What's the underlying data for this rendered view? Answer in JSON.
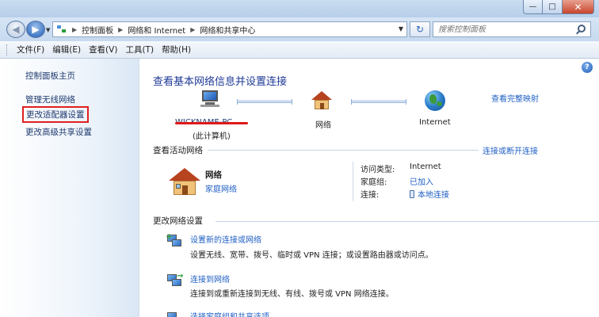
{
  "window": {
    "minimize": "—",
    "maximize": "□",
    "close": "✕"
  },
  "address": {
    "crumbs": [
      "控制面板",
      "网络和 Internet",
      "网络和共享中心"
    ],
    "search_placeholder": "搜索控制面板"
  },
  "menu": {
    "items": [
      "文件(F)",
      "编辑(E)",
      "查看(V)",
      "工具(T)",
      "帮助(H)"
    ]
  },
  "sidebar": {
    "items": [
      "控制面板主页",
      "管理无线网络",
      "更改适配器设置",
      "更改高级共享设置"
    ]
  },
  "main": {
    "title": "查看基本网络信息并设置连接",
    "full_map_link": "查看完整映射",
    "map": {
      "computer_name": "WICKNAME-PC",
      "computer_sub": "(此计算机)",
      "network": "网络",
      "internet": "Internet"
    },
    "active_header": "查看活动网络",
    "connect_link": "连接或断开连接",
    "active_network": {
      "name": "网络",
      "type": "家庭网络",
      "labels": [
        "访问类型:",
        "家庭组:",
        "连接:"
      ],
      "access_type": "Internet",
      "homegroup": "已加入",
      "connection": "本地连接"
    },
    "change_header": "更改网络设置",
    "tasks": [
      {
        "title": "设置新的连接或网络",
        "desc": "设置无线、宽带、拨号、临时或 VPN 连接；或设置路由器或访问点。"
      },
      {
        "title": "连接到网络",
        "desc": "连接到或重新连接到无线、有线、拨号或 VPN 网络连接。"
      },
      {
        "title": "选择家庭组和共享选项",
        "desc": ""
      }
    ]
  }
}
